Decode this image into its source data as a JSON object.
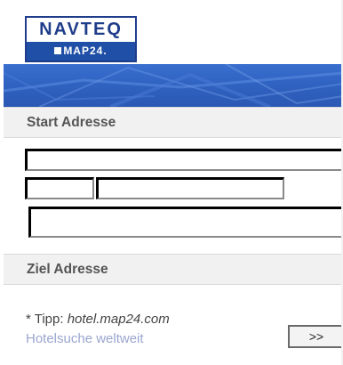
{
  "header": {
    "logo_brand": "NAVTEQ",
    "logo_sub": "MAP24."
  },
  "start_section": {
    "title": "Start Adresse",
    "street_value": "",
    "zip_value": "",
    "city_value": "",
    "country_value": ""
  },
  "dest_section": {
    "title": "Ziel Adresse"
  },
  "tip": {
    "prefix": "* Tipp: ",
    "domain": "hotel.map24.com",
    "link_label": "Hotelsuche weltweit"
  },
  "submit": {
    "label": ">>"
  },
  "colors": {
    "brand_blue": "#1f3d8a",
    "band_blue": "#3063c2",
    "section_bg": "#f1f1f1",
    "link": "#9aa6d0"
  }
}
